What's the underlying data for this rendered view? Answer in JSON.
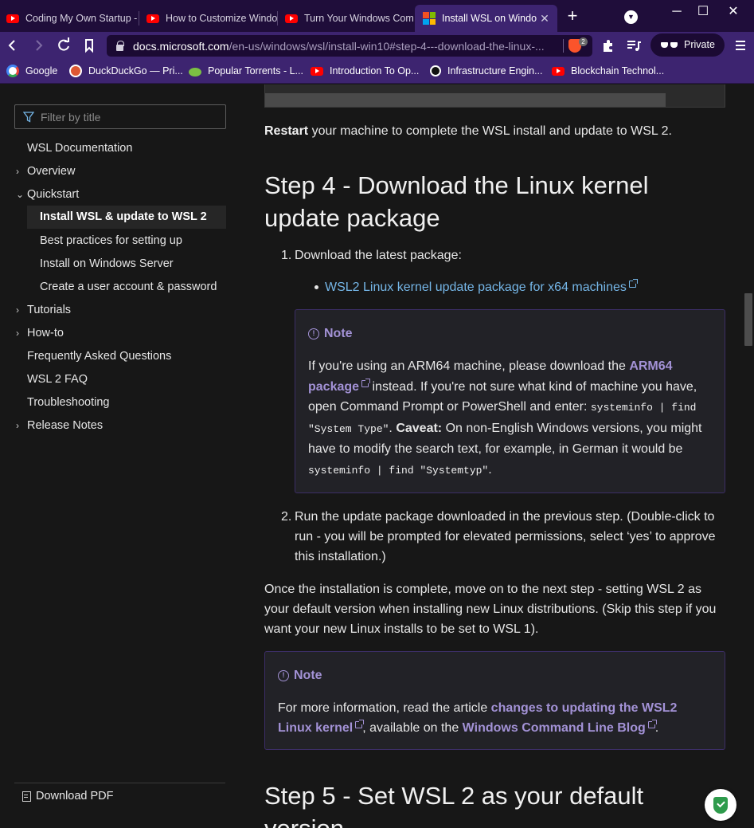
{
  "tabs": [
    {
      "title": "Coding My Own Startup -",
      "icon": "youtube-icon"
    },
    {
      "title": "How to Customize Windo",
      "icon": "youtube-icon"
    },
    {
      "title": "Turn Your Windows Comp",
      "icon": "youtube-icon"
    },
    {
      "title": "Install WSL on Windo",
      "icon": "microsoft-icon",
      "active": true
    }
  ],
  "window": {
    "new_tab": "+",
    "minimize": "─",
    "maximize": "☐",
    "close": "✕"
  },
  "nav": {
    "url_host": "docs.microsoft.com",
    "url_path": "/en-us/windows/wsl/install-win10#step-4---download-the-linux-...",
    "shields_count": "2",
    "private_label": "Private"
  },
  "bookmarks": [
    {
      "label": "Google",
      "icon": "google-icon",
      "color": "#4285f4"
    },
    {
      "label": "DuckDuckGo — Pri...",
      "icon": "duckduckgo-icon",
      "color": "#de5833"
    },
    {
      "label": "Popular Torrents - L...",
      "icon": "torrent-icon",
      "color": "#7bc043"
    },
    {
      "label": "Introduction To Op...",
      "icon": "youtube-icon",
      "color": "#ff0000"
    },
    {
      "label": "Infrastructure Engin...",
      "icon": "github-icon",
      "color": "#ffffff"
    },
    {
      "label": "Blockchain Technol...",
      "icon": "youtube-icon",
      "color": "#ff0000"
    }
  ],
  "sidebar": {
    "filter_placeholder": "Filter by title",
    "items": [
      {
        "label": "WSL Documentation"
      },
      {
        "label": "Overview",
        "chevron": "right"
      },
      {
        "label": "Quickstart",
        "chevron": "down"
      },
      {
        "label": "Install WSL & update to WSL 2",
        "active": true
      },
      {
        "label": "Best practices for setting up"
      },
      {
        "label": "Install on Windows Server"
      },
      {
        "label": "Create a user account & password"
      },
      {
        "label": "Tutorials",
        "chevron": "right"
      },
      {
        "label": "How-to",
        "chevron": "right"
      },
      {
        "label": "Frequently Asked Questions"
      },
      {
        "label": "WSL 2 FAQ"
      },
      {
        "label": "Troubleshooting"
      },
      {
        "label": "Release Notes",
        "chevron": "right"
      }
    ],
    "download_pdf": "Download PDF"
  },
  "content": {
    "restart_bold": "Restart",
    "restart_rest": " your machine to complete the WSL install and update to WSL 2.",
    "step4_heading_l1": "Step 4 - Download the Linux kernel",
    "step4_heading_l2": "update package",
    "li1_num": "1.",
    "li1_text": "Download the latest package:",
    "li1_link": "WSL2 Linux kernel update package for x64 machines",
    "note1": {
      "heading": "Note",
      "t1": "If you're using an ARM64 machine, please download the ",
      "link": "ARM64 package",
      "t2": " instead. If you're not sure what kind of machine you have, open Command Prompt or PowerShell and enter: ",
      "code1": "systeminfo | find \"System Type\"",
      "t3": ". ",
      "caveat": "Caveat:",
      "t4": " On non-English Windows versions, you might have to modify the search text, for example, in German it would be ",
      "code2": "systeminfo | find \"Systemtyp\"",
      "t5": "."
    },
    "li2_num": "2.",
    "li2_text": "Run the update package downloaded in the previous step. (Double-click to run - you will be prompted for elevated permissions, select ‘yes’ to approve this installation.)",
    "after_text": "Once the installation is complete, move on to the next step - setting WSL 2 as your default version when installing new Linux distributions. (Skip this step if you want your new Linux installs to be set to WSL 1).",
    "note2": {
      "heading": "Note",
      "t1": "For more information, read the article ",
      "link1": "changes to updating the WSL2 Linux kernel",
      "t2": ", available on the ",
      "link2": "Windows Command Line Blog",
      "t3": "."
    },
    "step5_heading_l1": "Step 5 - Set WSL 2 as your default",
    "step5_heading_l2": "version"
  },
  "colors": {
    "tabbar_bg": "#1f0d3a",
    "toolbar_bg": "#3d2470",
    "page_bg": "#171717",
    "link": "#75b6e7",
    "note_accent": "#a392d6"
  }
}
